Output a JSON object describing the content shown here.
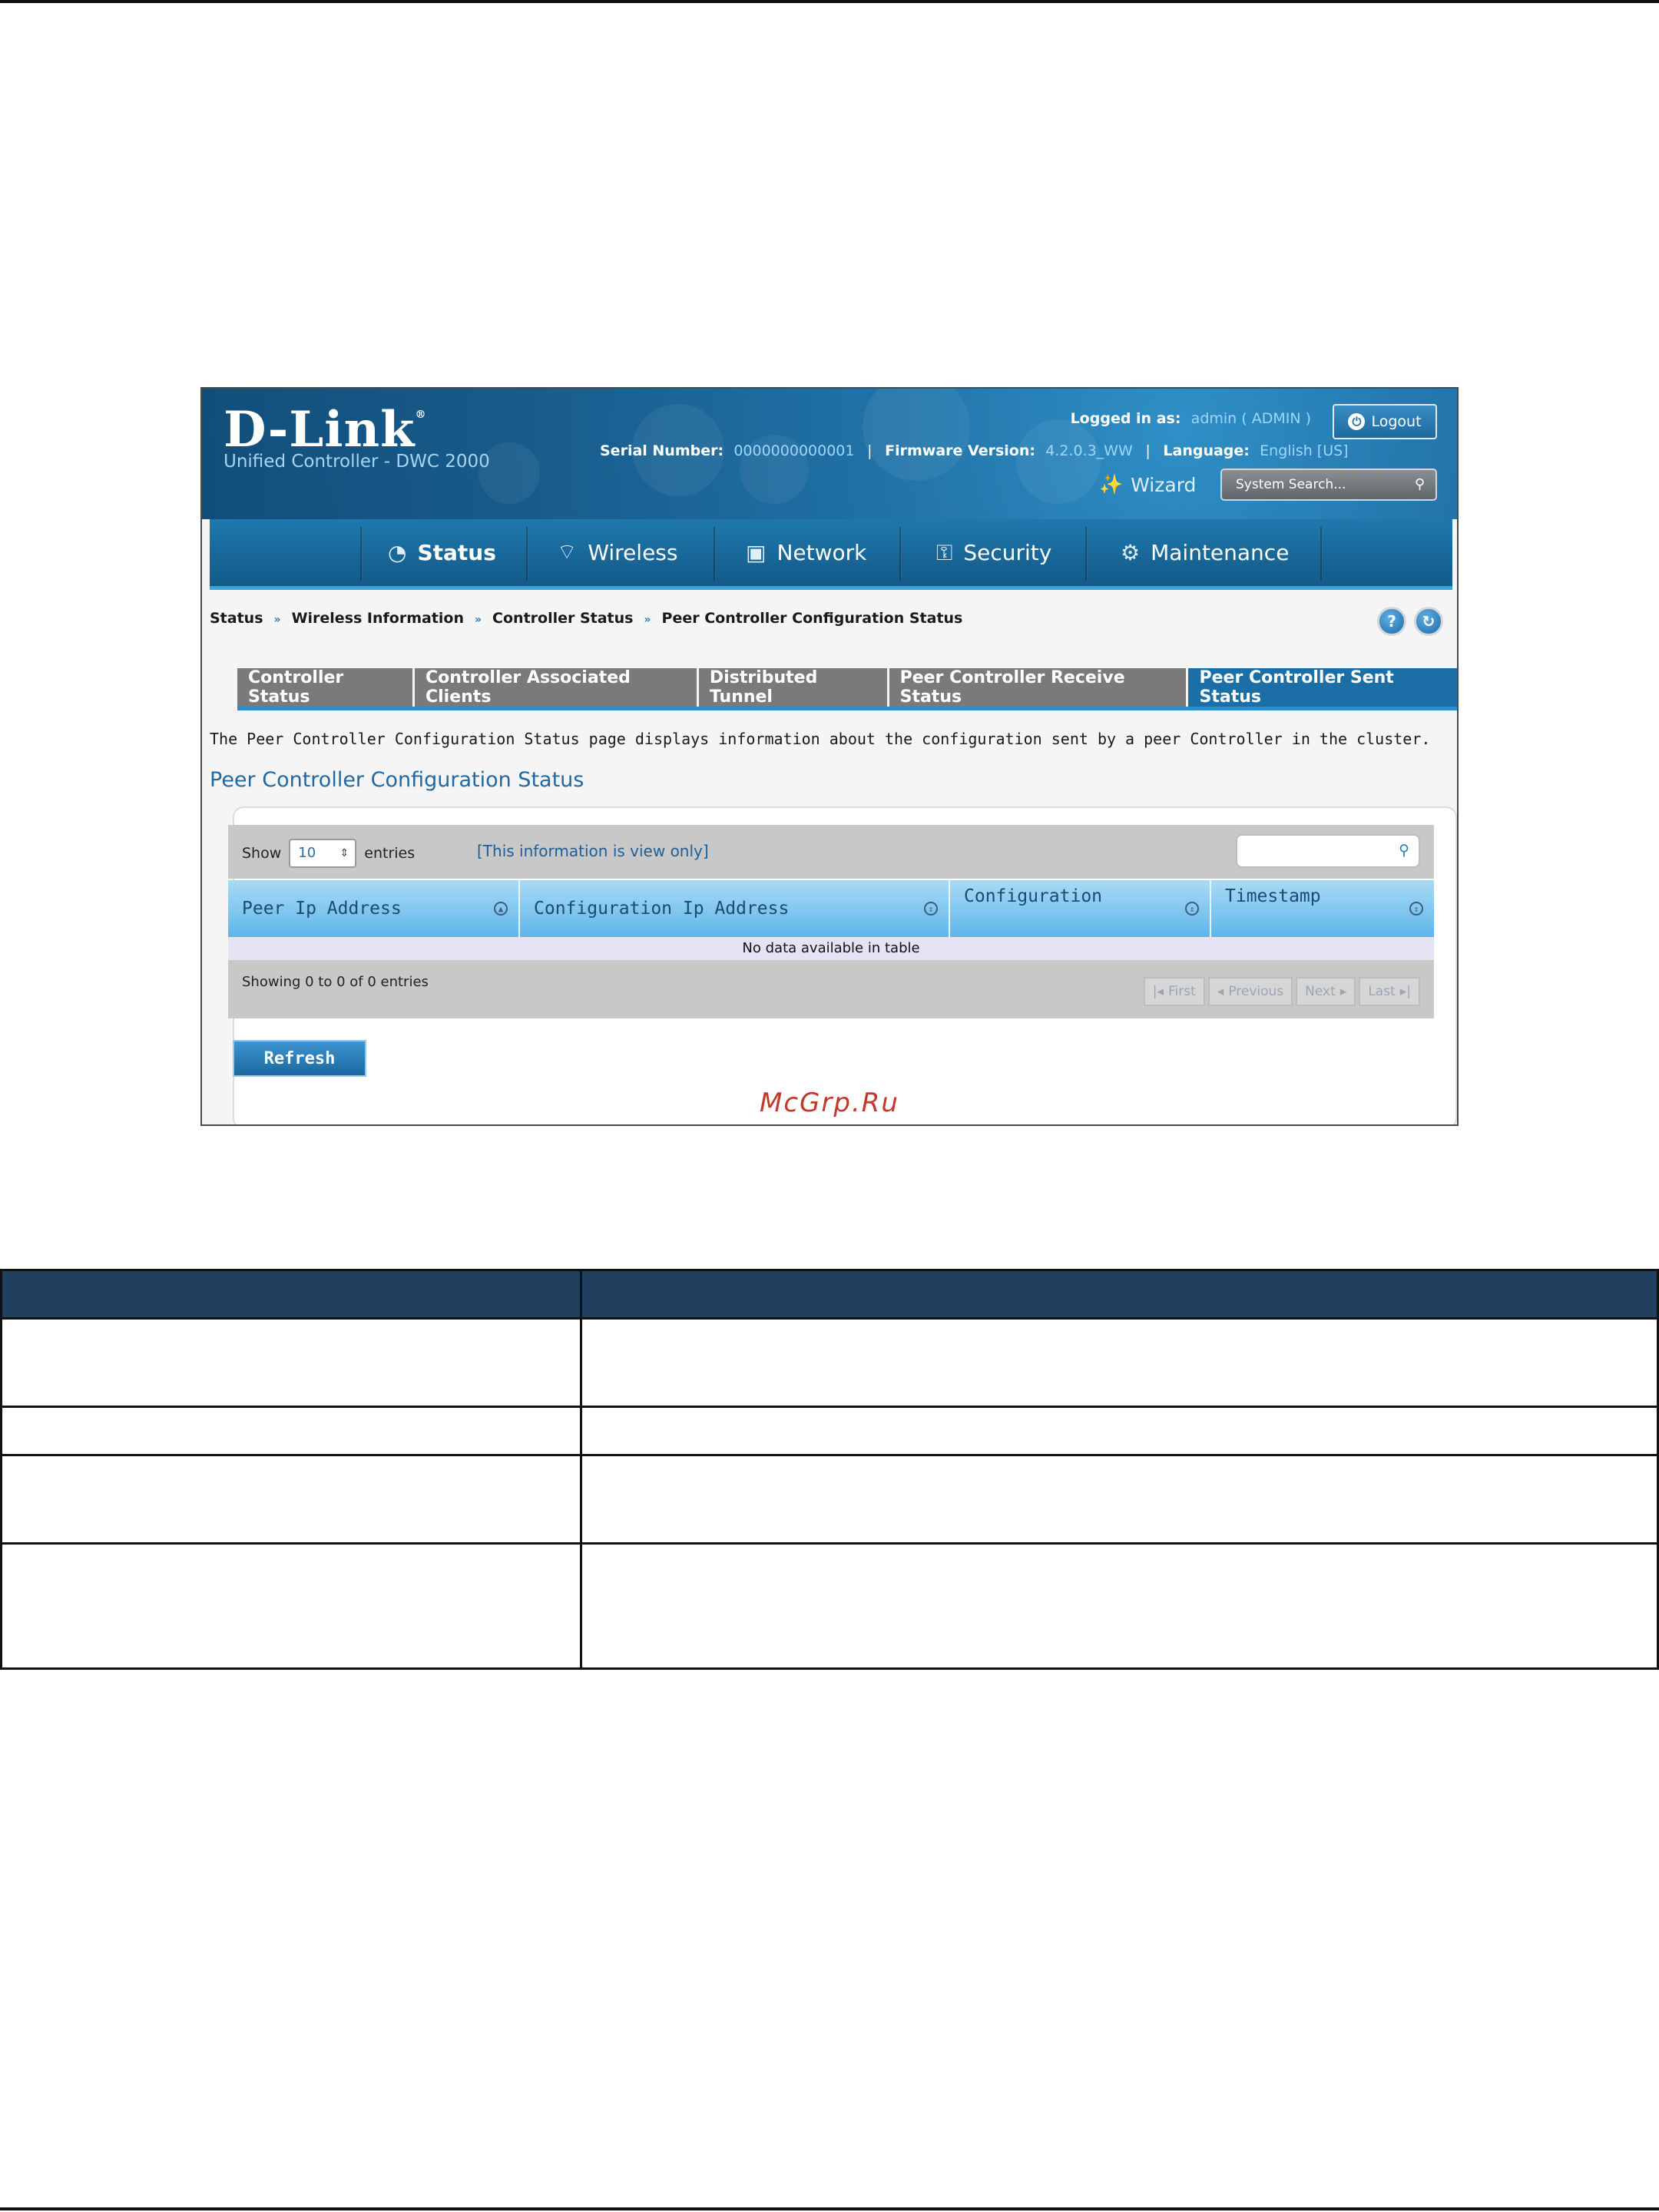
{
  "header": {
    "brand": "D-Link",
    "subtitle": "Unified Controller - DWC 2000",
    "logged_in_label": "Logged in as:",
    "logged_in_user": "admin ( ADMIN )",
    "logout_label": "Logout",
    "serial_label": "Serial Number:",
    "serial_value": "0000000000001",
    "firmware_label": "Firmware Version:",
    "firmware_value": "4.2.0.3_WW",
    "language_label": "Language:",
    "language_value": "English [US]",
    "wizard_label": "Wizard",
    "search_placeholder": "System Search..."
  },
  "nav": {
    "items": [
      {
        "label": "Status",
        "icon": "gauge-icon",
        "active": true
      },
      {
        "label": "Wireless",
        "icon": "wifi-icon"
      },
      {
        "label": "Network",
        "icon": "monitor-icon"
      },
      {
        "label": "Security",
        "icon": "lock-icon"
      },
      {
        "label": "Maintenance",
        "icon": "gear-icon"
      }
    ]
  },
  "breadcrumb": [
    "Status",
    "Wireless Information",
    "Controller Status",
    "Peer Controller Configuration Status"
  ],
  "tabs": [
    {
      "label": "Controller Status"
    },
    {
      "label": "Controller Associated Clients"
    },
    {
      "label": "Distributed Tunnel"
    },
    {
      "label": "Peer Controller Receive Status"
    },
    {
      "label": "Peer Controller Sent Status",
      "active": true
    }
  ],
  "page": {
    "description": "The Peer Controller Configuration Status page displays information about the configuration sent by a peer Controller in the cluster.",
    "section_title": "Peer Controller Configuration Status"
  },
  "table": {
    "show_label": "Show",
    "entries_value": "10",
    "entries_label": "entries",
    "view_only_note": "[This information is view only]",
    "columns": [
      "Peer Ip Address",
      "Configuration Ip Address",
      "Configuration",
      "Timestamp"
    ],
    "empty_message": "No data available in table",
    "showing_text": "Showing 0 to 0 of 0 entries",
    "pager": {
      "first": "First",
      "previous": "Previous",
      "next": "Next",
      "last": "Last"
    }
  },
  "refresh_label": "Refresh",
  "watermark": "McGrp.Ru",
  "colors": {
    "header_blue": "#1f6fa3",
    "tab_active": "#1c6fa6",
    "table_header": "#213f5e"
  }
}
